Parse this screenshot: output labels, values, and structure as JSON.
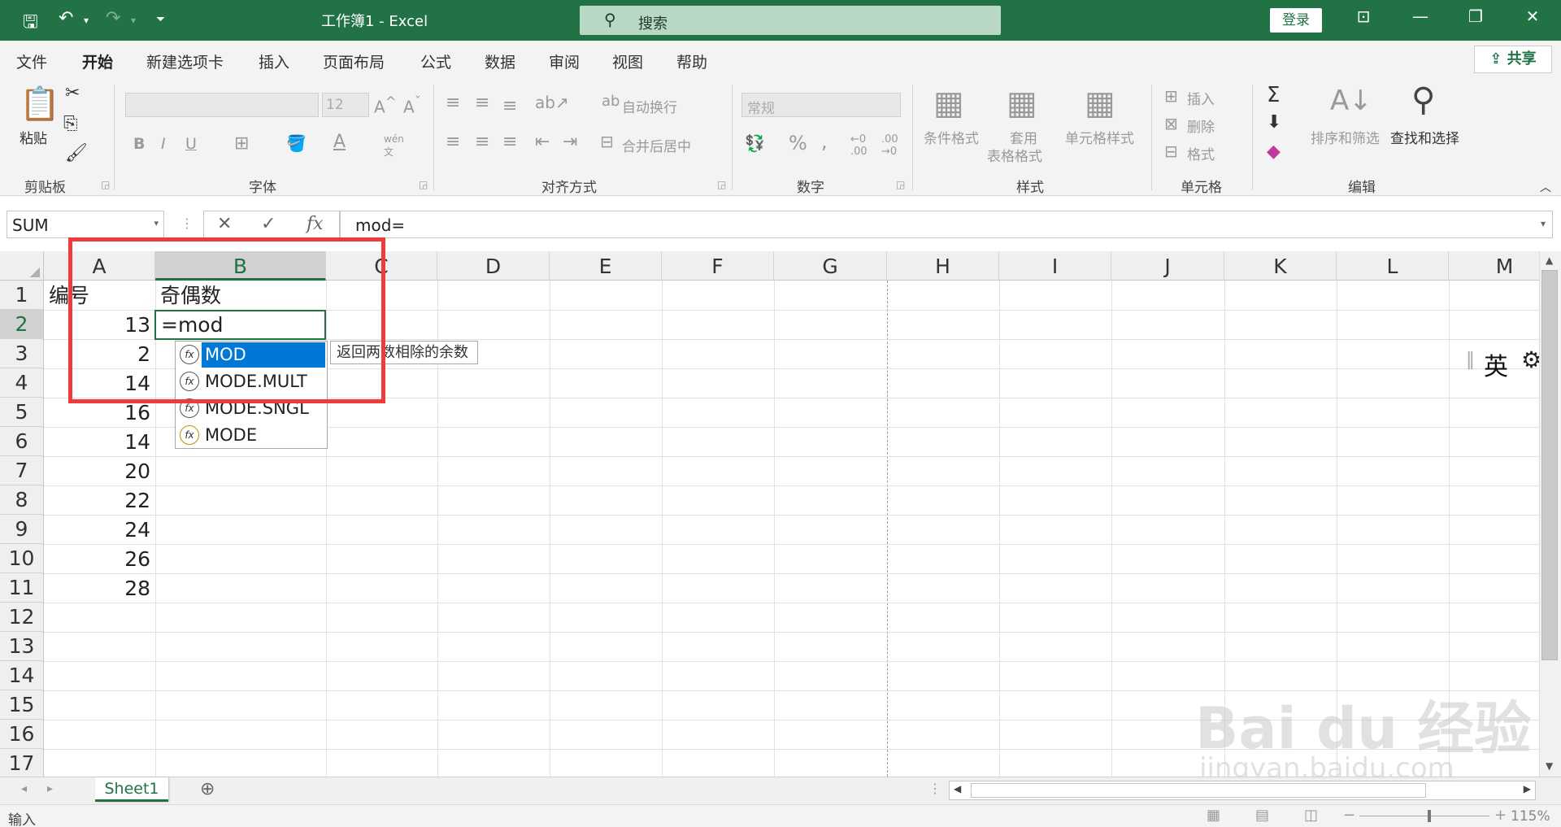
{
  "titlebar": {
    "title": "工作簿1  -  Excel",
    "search_placeholder": "搜索",
    "login_label": "登录"
  },
  "tabs": [
    "文件",
    "开始",
    "新建选项卡",
    "插入",
    "页面布局",
    "公式",
    "数据",
    "审阅",
    "视图",
    "帮助"
  ],
  "active_tab": "开始",
  "share_label": "共享",
  "ribbon": {
    "groups": {
      "clipboard": "剪贴板",
      "font": "字体",
      "alignment": "对齐方式",
      "number": "数字",
      "styles": "样式",
      "cells": "单元格",
      "editing": "编辑"
    },
    "paste": "粘贴",
    "font_size": "12",
    "wrap_text": "自动换行",
    "merge_center": "合并后居中",
    "number_format": "常规",
    "conditional_format": "条件格式",
    "table_format_1": "套用",
    "table_format_2": "表格格式",
    "cell_styles": "单元格样式",
    "insert": "插入",
    "delete": "删除",
    "format": "格式",
    "sort_filter": "排序和筛选",
    "find_select": "查找和选择"
  },
  "formula_bar": {
    "name_box": "SUM",
    "formula": "mod="
  },
  "columns": [
    "A",
    "B",
    "C",
    "D",
    "E",
    "F",
    "G",
    "H",
    "I",
    "J",
    "K",
    "L",
    "M"
  ],
  "rows": [
    "1",
    "2",
    "3",
    "4",
    "5",
    "6",
    "7",
    "8",
    "9",
    "10",
    "11",
    "12",
    "13",
    "14",
    "15",
    "16",
    "17"
  ],
  "cells": {
    "A1": "编号",
    "B1": "奇偶数",
    "A_values": [
      "13",
      "2",
      "14",
      "16",
      "14",
      "20",
      "22",
      "24",
      "26",
      "28"
    ],
    "B2_edit": "=mod"
  },
  "autocomplete": {
    "items": [
      "MOD",
      "MODE.MULT",
      "MODE.SNGL",
      "MODE"
    ],
    "tooltip": "返回两数相除的余数"
  },
  "ime": {
    "lang": "英"
  },
  "sheet_tabs": [
    "Sheet1"
  ],
  "status": {
    "mode": "输入",
    "zoom": "115%"
  },
  "watermark": {
    "brand": "Bai du 经验",
    "url": "jingyan.baidu.com"
  }
}
